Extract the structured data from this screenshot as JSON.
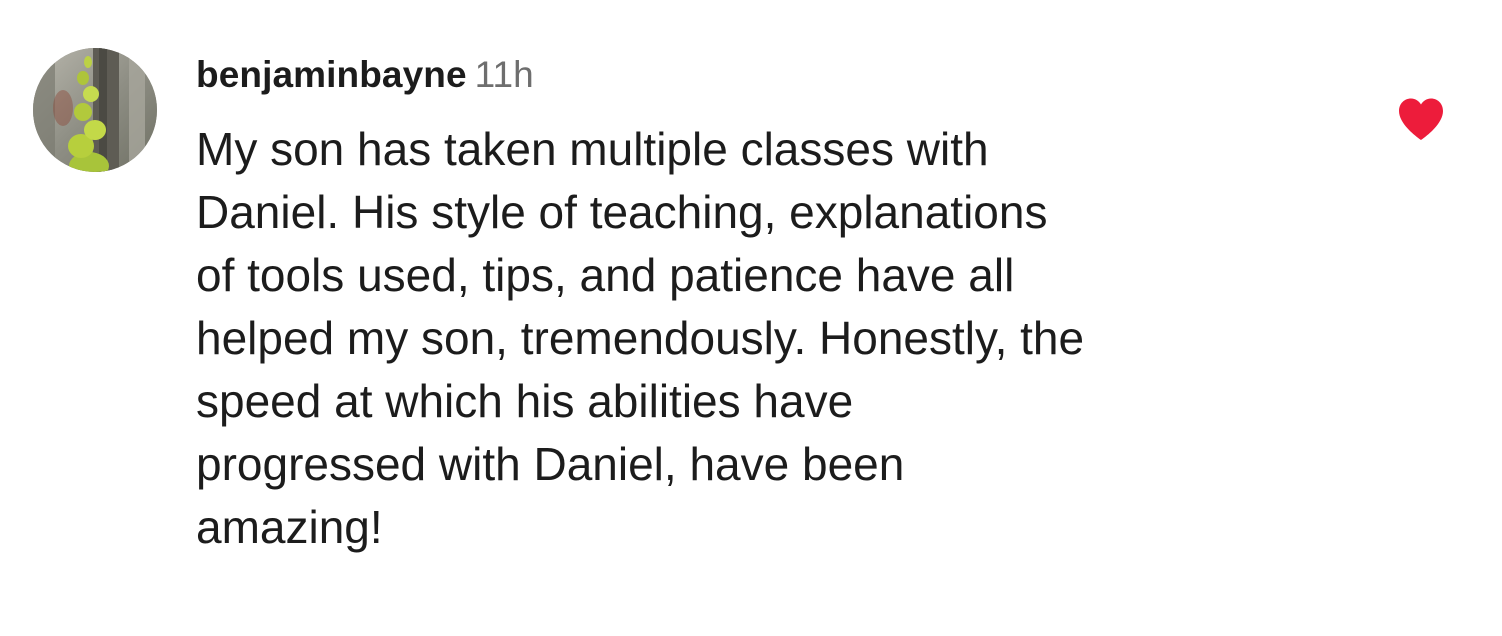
{
  "comment": {
    "username": "benjaminbayne",
    "timestamp": "11h",
    "text_lines": [
      "My son has taken multiple classes with",
      "Daniel. His style of teaching, explanations",
      "of tools used, tips, and patience have all",
      "helped my son, tremendously. Honestly, the",
      "speed at which his abilities have",
      "progressed with Daniel, have been",
      "amazing!"
    ],
    "avatar": {
      "icon": "avatar-photo-mossy-tree"
    },
    "like": {
      "icon": "heart-icon",
      "liked": true,
      "color": "#ed1c3b"
    }
  },
  "colors": {
    "background": "#ffffff",
    "text": "#1c1c1c",
    "secondary_text": "#6e6e6e",
    "like_red": "#ed1c3b"
  }
}
